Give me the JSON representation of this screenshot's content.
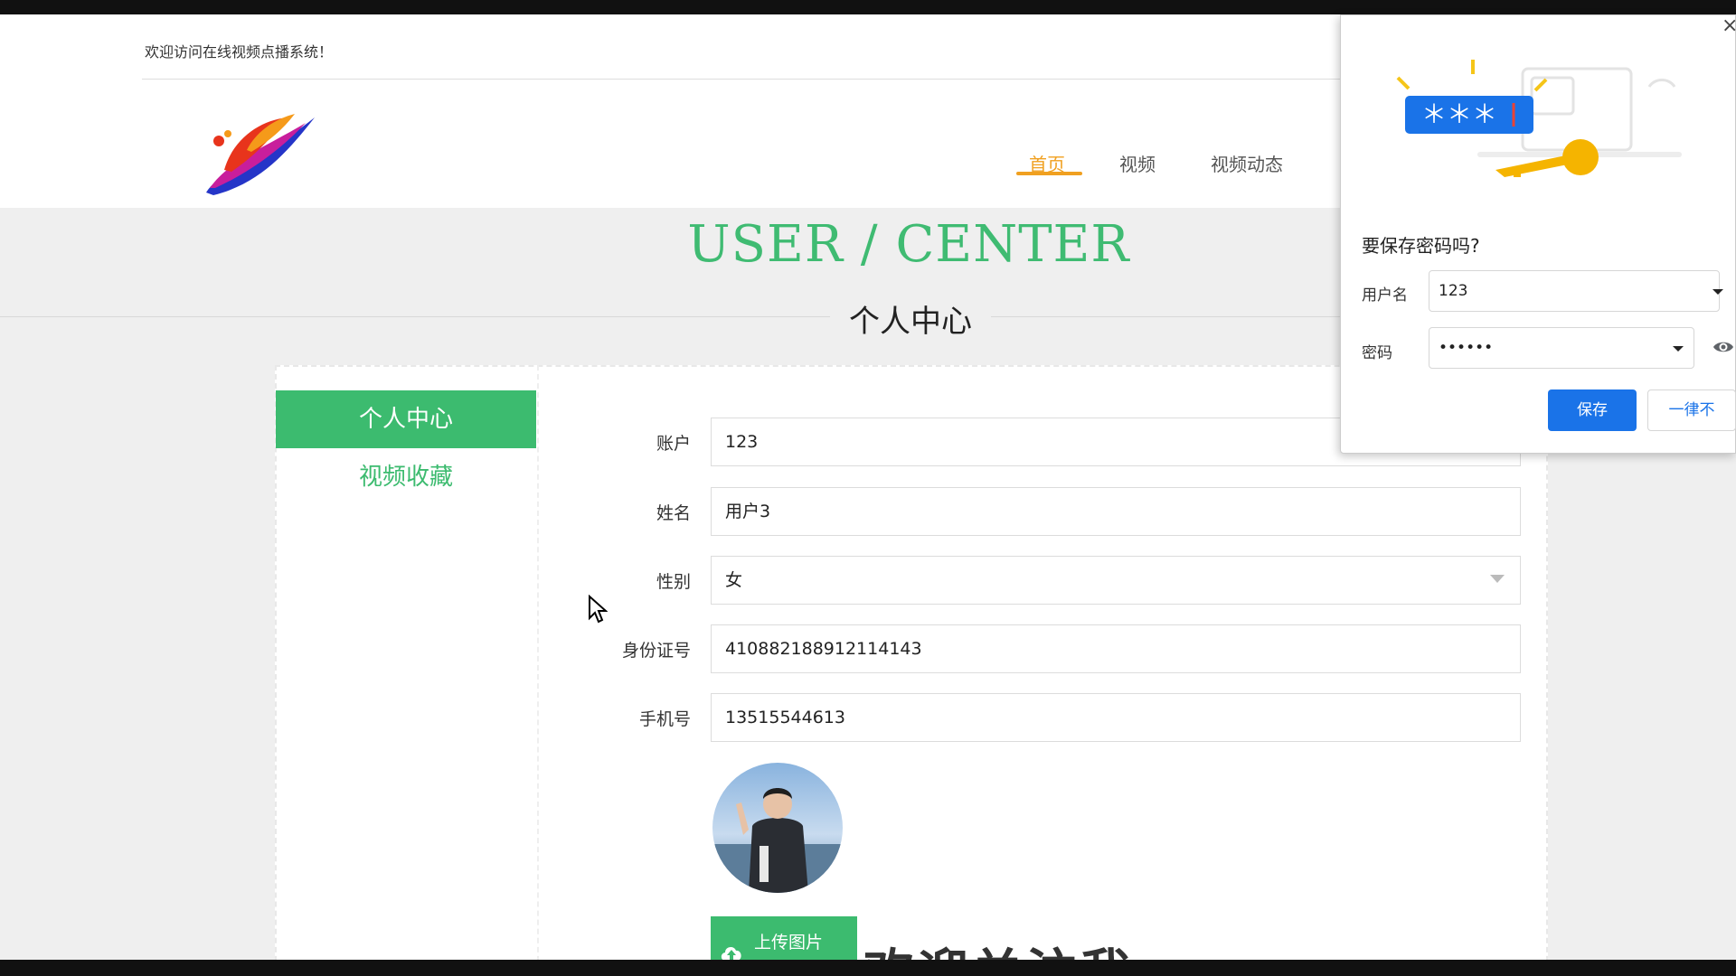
{
  "site": {
    "welcome": "欢迎访问在线视频点播系统！",
    "nav": [
      {
        "label": "首页",
        "active": true
      },
      {
        "label": "视频",
        "active": false
      },
      {
        "label": "视频动态",
        "active": false
      }
    ]
  },
  "hero": {
    "title_en": "USER / CENTER",
    "title_cn": "个人中心"
  },
  "sidebar": {
    "items": [
      {
        "label": "个人中心",
        "active": true
      },
      {
        "label": "视频收藏",
        "active": false
      }
    ]
  },
  "form": {
    "fields": [
      {
        "label": "账户",
        "value": "123"
      },
      {
        "label": "姓名",
        "value": "用户3"
      },
      {
        "label": "性别",
        "value": "女"
      },
      {
        "label": "身份证号",
        "value": "410882188912114143"
      },
      {
        "label": "手机号",
        "value": "13515544613"
      }
    ],
    "upload_label": "上传图片"
  },
  "overlay_text": "欢迎关注我",
  "save_password_popup": {
    "stars": "＊＊＊",
    "title": "要保存密码吗?",
    "username_label": "用户名",
    "username_value": "123",
    "password_label": "密码",
    "password_value": "••••••",
    "save_label": "保存",
    "never_label": "一律不",
    "close": "×"
  },
  "colors": {
    "accent_green": "#3cbb6f",
    "nav_active": "#f0a020",
    "chrome_blue": "#1a73e8"
  }
}
